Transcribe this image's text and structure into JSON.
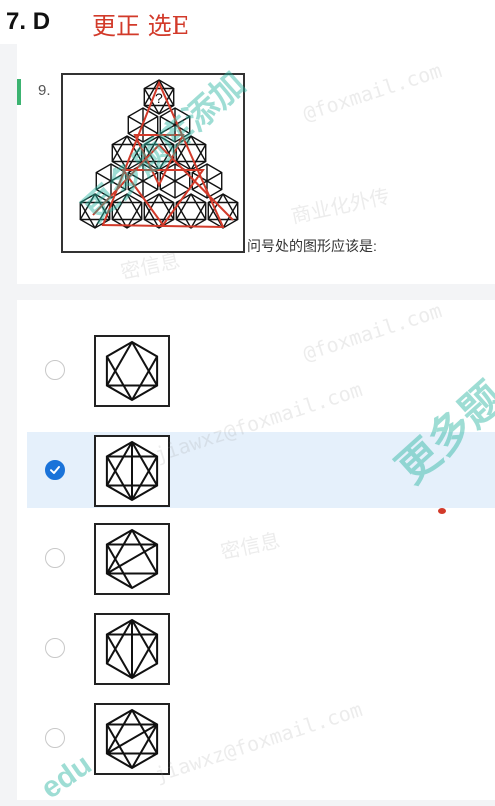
{
  "top_note": {
    "number": "7.",
    "answer": "D",
    "correction": "更正  选E"
  },
  "question": {
    "number": "9.",
    "text": "问号处的图形应该是:"
  },
  "options": [
    {
      "id": "A",
      "selected": false
    },
    {
      "id": "B",
      "selected": true
    },
    {
      "id": "C",
      "selected": false
    },
    {
      "id": "D",
      "selected": false
    },
    {
      "id": "E",
      "selected": false
    }
  ],
  "watermarks": [
    "@foxmail.com",
    "@foxmail.com",
    "jiawxz@foxmail.com",
    "jiawxz@foxmail.com",
    "更多题库添加",
    "更多题",
    "密信息",
    "商业化外传",
    "密信息",
    "edu"
  ],
  "colors": {
    "accent_green": "#3cb371",
    "selected_bg": "#e5f0fb",
    "radio_checked": "#1a73d9",
    "annotation_red": "#d23a2a"
  },
  "icons": {
    "radio_checked": "check-icon"
  }
}
